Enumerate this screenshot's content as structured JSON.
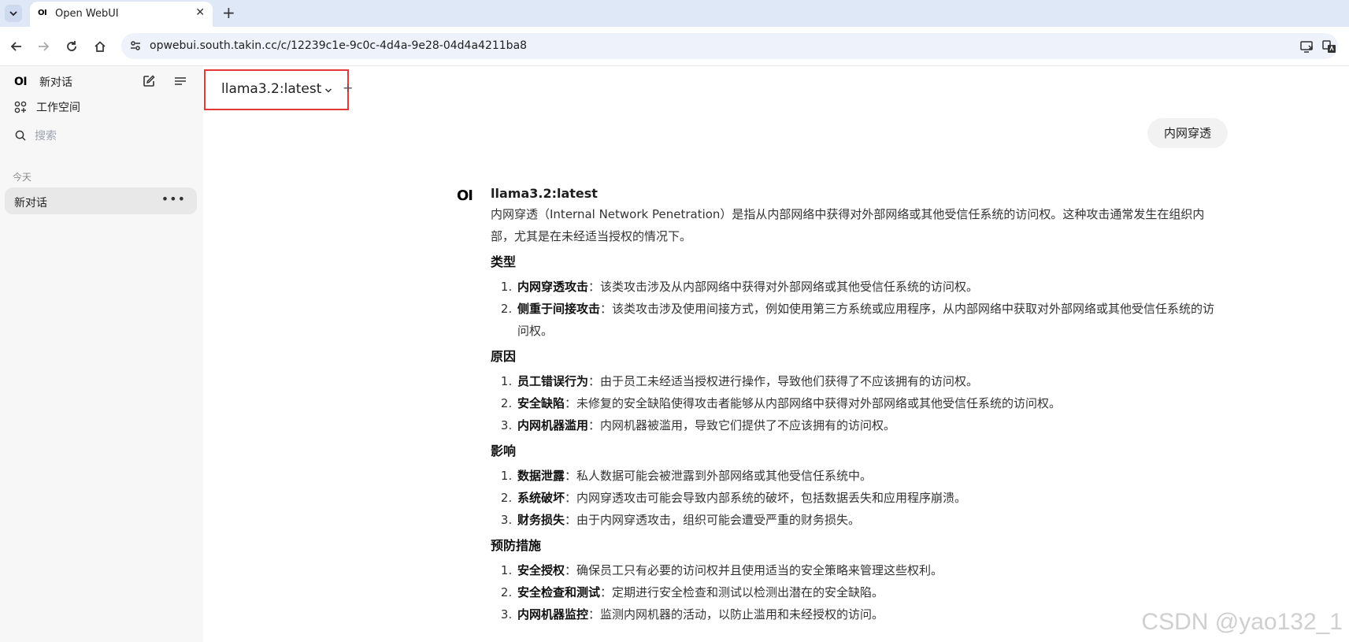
{
  "browser": {
    "tab_title": "Open WebUI",
    "tab_favicon": "OI",
    "url": "opwebui.south.takin.cc/c/12239c1e-9c0c-4d4a-9e28-04d4a4211ba8"
  },
  "sidebar": {
    "logo": "OI",
    "new_chat": "新对话",
    "workspace": "工作空间",
    "search_placeholder": "搜索",
    "section_today": "今天",
    "chats": [
      {
        "label": "新对话"
      }
    ]
  },
  "model_selector": {
    "name": "llama3.2:latest"
  },
  "user_message": "内网穿透",
  "assistant": {
    "logo": "OI",
    "name": "llama3.2:latest",
    "intro": "内网穿透（Internal Network Penetration）是指从内部网络中获得对外部网络或其他受信任系统的访问权。这种攻击通常发生在组织内部，尤其是在未经适当授权的情况下。",
    "sections": [
      {
        "heading": "类型",
        "items": [
          {
            "term": "内网穿透攻击",
            "desc": "：该类攻击涉及从内部网络中获得对外部网络或其他受信任系统的访问权。"
          },
          {
            "term": "侧重于间接攻击",
            "desc": "：该类攻击涉及使用间接方式，例如使用第三方系统或应用程序，从内部网络中获取对外部网络或其他受信任系统的访问权。"
          }
        ]
      },
      {
        "heading": "原因",
        "items": [
          {
            "term": "员工错误行为",
            "desc": "：由于员工未经适当授权进行操作，导致他们获得了不应该拥有的访问权。"
          },
          {
            "term": "安全缺陷",
            "desc": "：未修复的安全缺陷使得攻击者能够从内部网络中获得对外部网络或其他受信任系统的访问权。"
          },
          {
            "term": "内网机器滥用",
            "desc": "：内网机器被滥用，导致它们提供了不应该拥有的访问权。"
          }
        ]
      },
      {
        "heading": "影响",
        "items": [
          {
            "term": "数据泄露",
            "desc": "：私人数据可能会被泄露到外部网络或其他受信任系统中。"
          },
          {
            "term": "系统破坏",
            "desc": "：内网穿透攻击可能会导致内部系统的破坏，包括数据丢失和应用程序崩溃。"
          },
          {
            "term": "财务损失",
            "desc": "：由于内网穿透攻击，组织可能会遭受严重的财务损失。"
          }
        ]
      },
      {
        "heading": "预防措施",
        "items": [
          {
            "term": "安全授权",
            "desc": "：确保员工只有必要的访问权并且使用适当的安全策略来管理这些权利。"
          },
          {
            "term": "安全检查和测试",
            "desc": "：定期进行安全检查和测试以检测出潜在的安全缺陷。"
          },
          {
            "term": "内网机器监控",
            "desc": "：监测内网机器的活动，以防止滥用和未经授权的访问。"
          }
        ]
      }
    ]
  },
  "watermark": "CSDN @yao132_1"
}
